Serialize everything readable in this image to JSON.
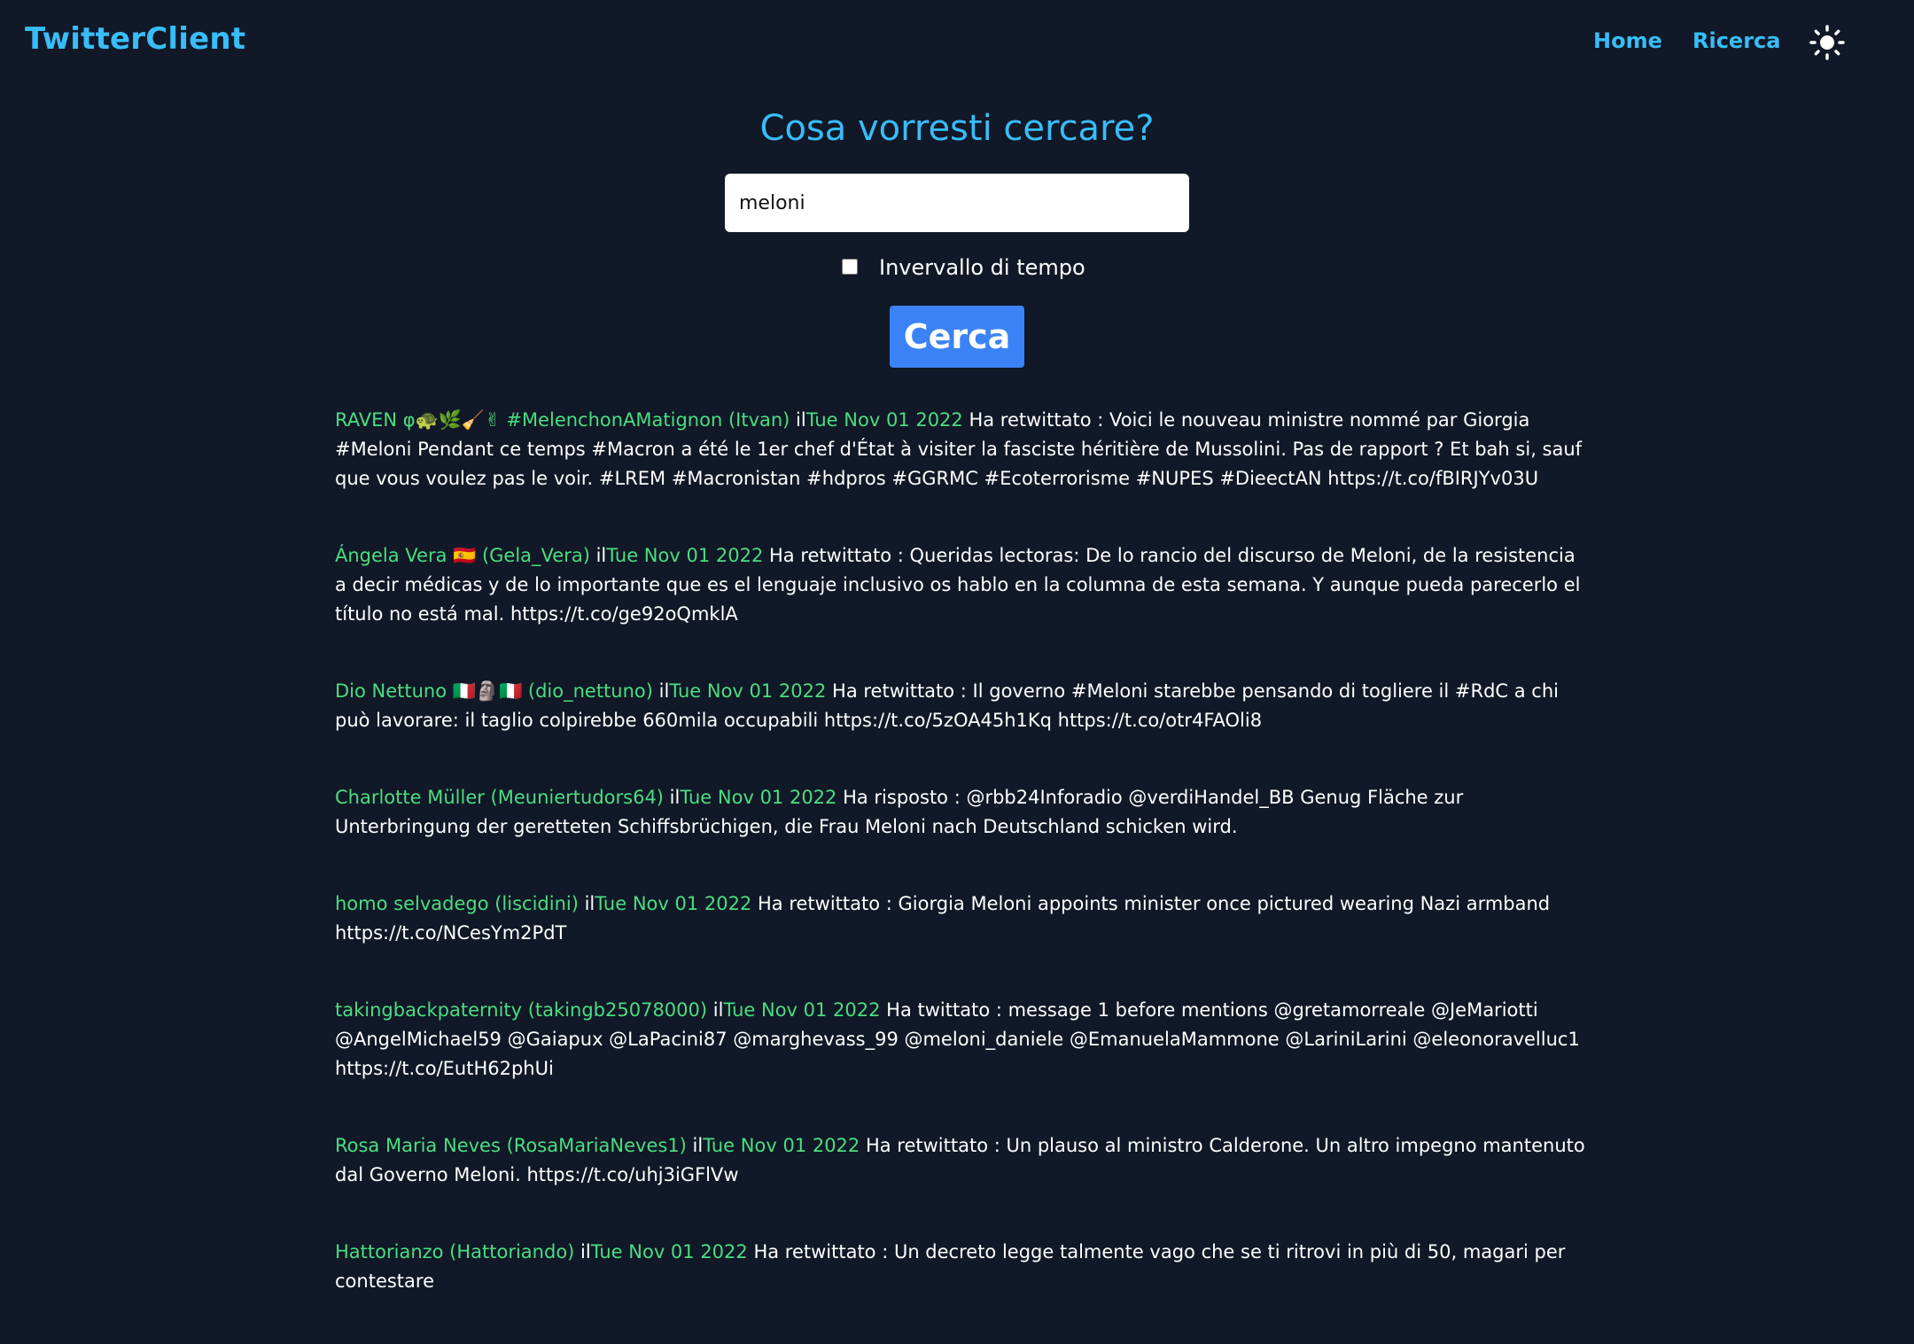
{
  "header": {
    "brand": "TwitterClient",
    "nav": {
      "home": "Home",
      "search": "Ricerca"
    },
    "theme_toggle_icon": "sun-icon"
  },
  "search": {
    "title": "Cosa vorresti cercare?",
    "query": "meloni",
    "range_label": "Invervallo di tempo",
    "range_checked": false,
    "button_label": "Cerca"
  },
  "colors": {
    "background": "#111827",
    "accent": "#38bdf8",
    "author": "#4ade80",
    "button": "#3b82f6"
  },
  "tweets": [
    {
      "author": "RAVEN φ🐢🌿🧹✌ #MelenchonAMatignon (Itvan)",
      "sep": " il",
      "date": "Tue Nov 01 2022",
      "text": " Ha retwittato : Voici le nouveau ministre nommé par Giorgia #Meloni Pendant ce temps #Macron a été le 1er chef d'État à visiter la fasciste héritière de Mussolini. Pas de rapport ? Et bah si, sauf que vous voulez pas le voir. #LREM #Macronistan #hdpros #GGRMC #Ecoterrorisme #NUPES #DieectAN https://t.co/fBIRJYv03U"
    },
    {
      "author": "Ángela Vera 🇪🇸 (Gela_Vera)",
      "sep": " il",
      "date": "Tue Nov 01 2022",
      "text": " Ha retwittato : Queridas lectoras: De lo rancio del discurso de Meloni, de la resistencia a decir médicas y de lo importante que es el lenguaje inclusivo os hablo en la columna de esta semana. Y aunque pueda parecerlo el título no está mal. https://t.co/ge92oQmklA"
    },
    {
      "author": "Dio Nettuno 🇮🇹🗿🇮🇹 (dio_nettuno)",
      "sep": " il",
      "date": "Tue Nov 01 2022",
      "text": " Ha retwittato : Il governo #Meloni starebbe pensando di togliere il #RdC a chi può lavorare: il taglio colpirebbe 660mila occupabili https://t.co/5zOA45h1Kq https://t.co/otr4FAOli8"
    },
    {
      "author": "Charlotte Müller (Meuniertudors64)",
      "sep": " il",
      "date": "Tue Nov 01 2022",
      "text": " Ha risposto : @rbb24Inforadio @verdiHandel_BB Genug Fläche zur Unterbringung der geretteten Schiffsbrüchigen, die Frau Meloni nach Deutschland schicken wird."
    },
    {
      "author": "homo selvadego (liscidini)",
      "sep": " il",
      "date": "Tue Nov 01 2022",
      "text": " Ha retwittato : Giorgia Meloni appoints minister once pictured wearing Nazi armband https://t.co/NCesYm2PdT"
    },
    {
      "author": "takingbackpaternity (takingb25078000)",
      "sep": " il",
      "date": "Tue Nov 01 2022",
      "text": " Ha twittato : message 1 before mentions @gretamorreale @JeMariotti @AngelMichael59 @Gaiapux @LaPacini87 @marghevass_99 @meloni_daniele @EmanuelaMammone @LariniLarini @eleonoravelluc1 https://t.co/EutH62phUi"
    },
    {
      "author": "Rosa Maria Neves (RosaMariaNeves1)",
      "sep": " il",
      "date": "Tue Nov 01 2022",
      "text": " Ha retwittato : Un plauso al ministro Calderone. Un altro impegno mantenuto dal Governo Meloni. https://t.co/uhj3iGFlVw"
    },
    {
      "author": "Hattorianzo (Hattoriando)",
      "sep": " il",
      "date": "Tue Nov 01 2022",
      "text": " Ha retwittato : Un decreto legge talmente vago che se ti ritrovi in più di 50, magari per contestare"
    }
  ]
}
